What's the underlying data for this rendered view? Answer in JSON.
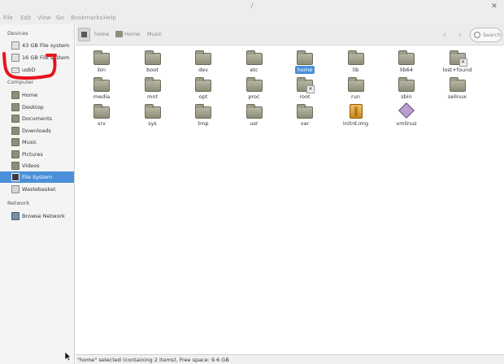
{
  "window": {
    "title": "/"
  },
  "menu": [
    "File",
    "Edit",
    "View",
    "Go",
    "Bookmarks",
    "Help"
  ],
  "sidebar": {
    "devices_heading": "Devices",
    "devices": [
      {
        "label": "43 GB File system",
        "icon": "drive-icon"
      },
      {
        "label": "16 GB File system",
        "icon": "drive-icon"
      },
      {
        "label": "usbD",
        "icon": "usb-drive-icon"
      }
    ],
    "computer_heading": "Computer",
    "computer": [
      {
        "label": "Home",
        "icon": "home-folder-icon"
      },
      {
        "label": "Desktop",
        "icon": "desktop-folder-icon"
      },
      {
        "label": "Documents",
        "icon": "documents-folder-icon"
      },
      {
        "label": "Downloads",
        "icon": "downloads-folder-icon"
      },
      {
        "label": "Music",
        "icon": "music-folder-icon"
      },
      {
        "label": "Pictures",
        "icon": "pictures-folder-icon"
      },
      {
        "label": "Videos",
        "icon": "videos-folder-icon"
      },
      {
        "label": "File System",
        "icon": "filesystem-icon",
        "selected": true
      },
      {
        "label": "Wastebasket",
        "icon": "trash-icon"
      }
    ],
    "network_heading": "Network",
    "network": [
      {
        "label": "Browse Network",
        "icon": "network-icon"
      }
    ]
  },
  "toolbar": {
    "crumbs": [
      "home",
      "Home",
      "Music"
    ],
    "search_label": "Search"
  },
  "files": [
    {
      "name": "bin",
      "type": "folder"
    },
    {
      "name": "boot",
      "type": "folder"
    },
    {
      "name": "dev",
      "type": "folder"
    },
    {
      "name": "etc",
      "type": "folder"
    },
    {
      "name": "home",
      "type": "folder",
      "selected": true
    },
    {
      "name": "lib",
      "type": "folder"
    },
    {
      "name": "lib64",
      "type": "folder"
    },
    {
      "name": "lost+found",
      "type": "folder-locked"
    },
    {
      "name": "media",
      "type": "folder"
    },
    {
      "name": "mnt",
      "type": "folder"
    },
    {
      "name": "opt",
      "type": "folder"
    },
    {
      "name": "proc",
      "type": "folder"
    },
    {
      "name": "root",
      "type": "folder-locked"
    },
    {
      "name": "run",
      "type": "folder"
    },
    {
      "name": "sbin",
      "type": "folder"
    },
    {
      "name": "selinux",
      "type": "folder"
    },
    {
      "name": "srv",
      "type": "folder"
    },
    {
      "name": "sys",
      "type": "folder"
    },
    {
      "name": "tmp",
      "type": "folder"
    },
    {
      "name": "usr",
      "type": "folder"
    },
    {
      "name": "var",
      "type": "folder"
    },
    {
      "name": "initrd.img",
      "type": "package"
    },
    {
      "name": "vmlinuz",
      "type": "binary"
    }
  ],
  "status": {
    "text": "\"home\" selected (containing 2 items), Free space: 9.6 GB"
  },
  "colors": {
    "selection": "#4a90d9",
    "annotation": "#e8141c"
  }
}
